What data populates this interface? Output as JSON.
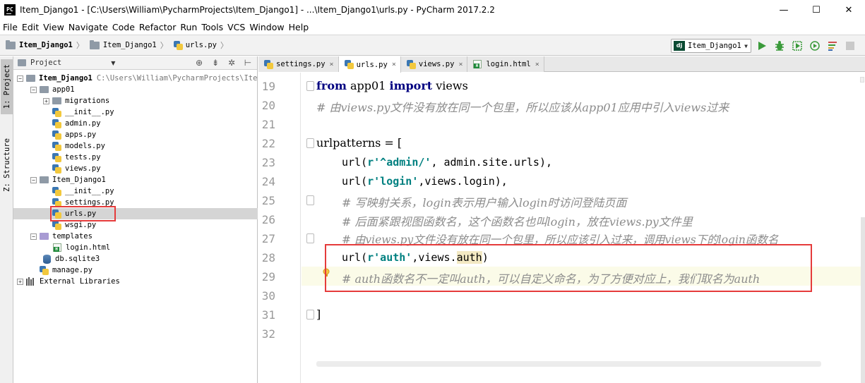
{
  "window": {
    "title": "Item_Django1 - [C:\\Users\\William\\PycharmProjects\\Item_Django1] - ...\\Item_Django1\\urls.py - PyCharm 2017.2.2",
    "logo_text": "PC",
    "controls": {
      "minimize": "—",
      "maximize": "☐",
      "close": "✕"
    }
  },
  "menu": [
    "File",
    "Edit",
    "View",
    "Navigate",
    "Code",
    "Refactor",
    "Run",
    "Tools",
    "VCS",
    "Window",
    "Help"
  ],
  "breadcrumb": {
    "items": [
      "Item_Django1",
      "Item_Django1",
      "urls.py"
    ],
    "separator": "〉"
  },
  "run_config": {
    "icon_text": "dj",
    "label": "Item_Django1",
    "dropdown": "▼"
  },
  "toolbar_icons": [
    "run-icon",
    "debug-icon",
    "coverage-icon",
    "profile-icon",
    "concurrency-icon",
    "stop-icon"
  ],
  "side_tabs": {
    "project": "1: Project",
    "structure": "Z: Structure"
  },
  "project_panel": {
    "header_label": "Project",
    "header_arrow": "▼",
    "header_icons": [
      "⊕",
      "⇟",
      "✲",
      "⊢"
    ],
    "tree": [
      {
        "label": "Item_Django1",
        "detail": "C:\\Users\\William\\PycharmProjects\\Ite",
        "icon": "folder",
        "expander": "−"
      },
      {
        "label": "app01",
        "icon": "folder",
        "expander": "−"
      },
      {
        "label": "migrations",
        "icon": "folder",
        "expander": "+"
      },
      {
        "label": "__init__.py",
        "icon": "python"
      },
      {
        "label": "admin.py",
        "icon": "python"
      },
      {
        "label": "apps.py",
        "icon": "python"
      },
      {
        "label": "models.py",
        "icon": "python"
      },
      {
        "label": "tests.py",
        "icon": "python"
      },
      {
        "label": "views.py",
        "icon": "python"
      },
      {
        "label": "Item_Django1",
        "icon": "folder",
        "expander": "−"
      },
      {
        "label": "__init__.py",
        "icon": "python"
      },
      {
        "label": "settings.py",
        "icon": "python"
      },
      {
        "label": "urls.py",
        "icon": "python",
        "selected": true
      },
      {
        "label": "wsgi.py",
        "icon": "python"
      },
      {
        "label": "templates",
        "icon": "folder",
        "expander": "−"
      },
      {
        "label": "login.html",
        "icon": "html"
      },
      {
        "label": "db.sqlite3",
        "icon": "database"
      },
      {
        "label": "manage.py",
        "icon": "python"
      },
      {
        "label": "External Libraries",
        "icon": "library",
        "expander": "+"
      }
    ]
  },
  "tabs": [
    {
      "label": "settings.py",
      "close": "×",
      "active": false
    },
    {
      "label": "urls.py",
      "close": "×",
      "active": true
    },
    {
      "label": "views.py",
      "close": "×",
      "active": false
    },
    {
      "label": "login.html",
      "close": "×",
      "active": false
    }
  ],
  "editor": {
    "line_numbers": [
      "19",
      "20",
      "21",
      "22",
      "23",
      "24",
      "25",
      "26",
      "27",
      "28",
      "29",
      "30",
      "31",
      "32"
    ],
    "code": {
      "l19_kw1": "from",
      "l19_mod": " app01 ",
      "l19_kw2": "import",
      "l19_name": " views",
      "l20": "# 由views.py文件没有放在同一个包里，所以应该从app01应用中引入views过来",
      "l22": "urlpatterns = [",
      "l23_a": "url(",
      "l23_str": "r'^admin/'",
      "l23_b": ", admin.site.urls),",
      "l24_a": "url(",
      "l24_str": "r'login'",
      "l24_b": ",views.login),",
      "l25": "# 写映射关系，login表示用户输入login时访问登陆页面",
      "l26": "# 后面紧跟视图函数名，这个函数名也叫login，放在views.py文件里",
      "l27": "# 由views.py文件没有放在同一个包里，所以应该引入过来，调用views下的login函数名",
      "l28_a": "url(",
      "l28_str": "r'auth'",
      "l28_b": ",views.",
      "l28_c": "auth",
      "l28_d": ")",
      "l29": "# auth函数名不一定叫auth，可以自定义命名，为了方便对应上，我们取名为auth",
      "l31": "]"
    }
  },
  "colors": {
    "keyword": "#000080",
    "string": "#008080",
    "comment": "#8c8c8c",
    "highlight_box": "#e53b3b",
    "selection": "#d5d5d5"
  }
}
